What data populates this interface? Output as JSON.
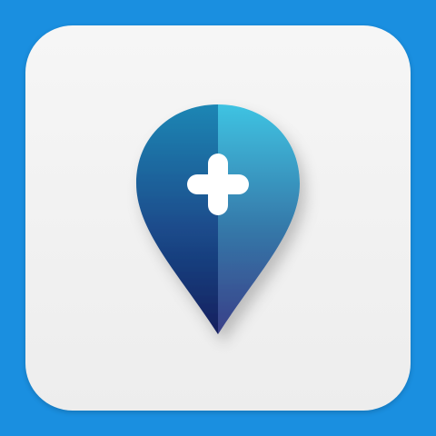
{
  "app_icon": {
    "name": "location-pin-plus-icon",
    "colors": {
      "background": "#1a8fe0",
      "tile": "#eeeeee",
      "pin_top_left": "#1e86b4",
      "pin_bottom_left": "#16205e",
      "pin_top_right": "#3fbfe0",
      "pin_bottom_right": "#3a3f88",
      "plus": "#ffffff"
    }
  }
}
